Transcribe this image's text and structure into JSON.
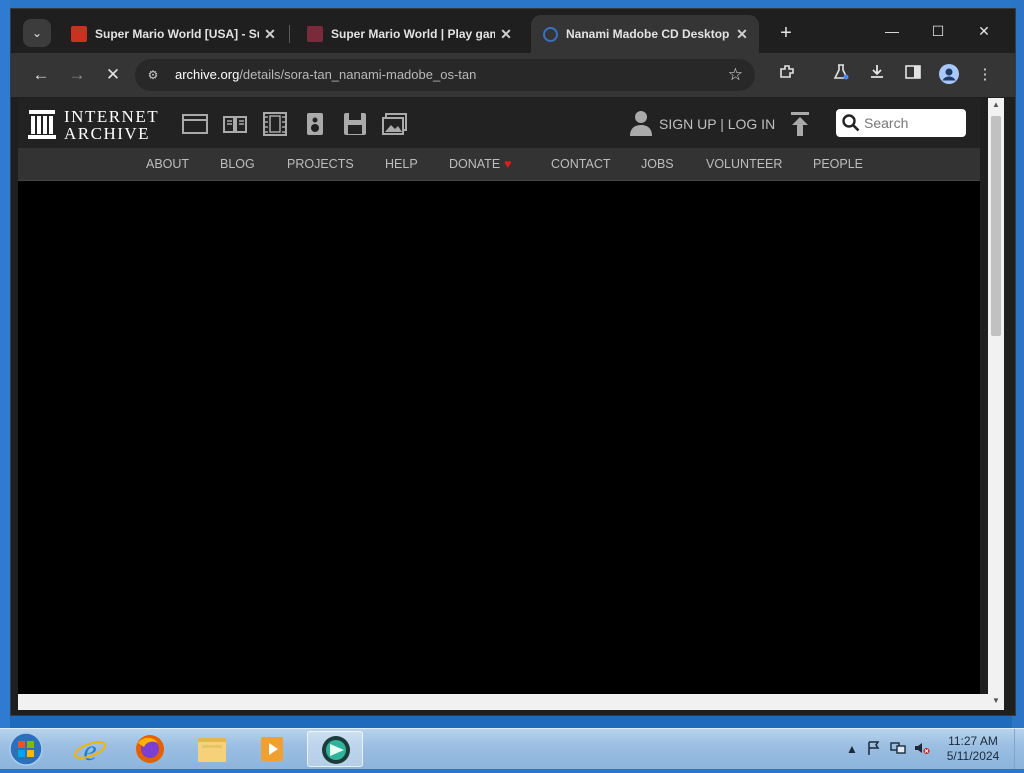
{
  "browser": {
    "tabs": [
      {
        "title": "Super Mario World [USA] - Su",
        "favicon_color": "#c8321e",
        "active": false
      },
      {
        "title": "Super Mario World | Play gam",
        "favicon_color": "#7a2a3a",
        "active": false
      },
      {
        "title": "Nanami Madobe CD Desktop I",
        "favicon_color": "#3a6fc4",
        "active": true
      }
    ],
    "tab_close_glyph": "✕",
    "new_tab_glyph": "+",
    "window_controls": {
      "minimize": "—",
      "maximize": "☐",
      "close": "✕"
    },
    "nav": {
      "back": "←",
      "forward": "→",
      "stop": "✕"
    },
    "omnibox": {
      "host": "archive.org",
      "path": "/details/sora-tan_nanami-madobe_os-tan"
    }
  },
  "ia": {
    "logo_line1": "INTERNET",
    "logo_line2": "ARCHIVE",
    "auth_text": "SIGN UP | LOG IN",
    "search_placeholder": "Search",
    "subnav": [
      "ABOUT",
      "BLOG",
      "PROJECTS",
      "HELP",
      "DONATE",
      "CONTACT",
      "JOBS",
      "VOLUNTEER",
      "PEOPLE"
    ],
    "donate_heart": "♥"
  },
  "taskbar": {
    "time": "11:27 AM",
    "date": "5/11/2024"
  },
  "colors": {
    "browser_dark": "#1f1f1f",
    "toolbar": "#353535",
    "ia_header": "#222222",
    "ia_subnav": "#333333",
    "heart": "#e21b1b"
  }
}
